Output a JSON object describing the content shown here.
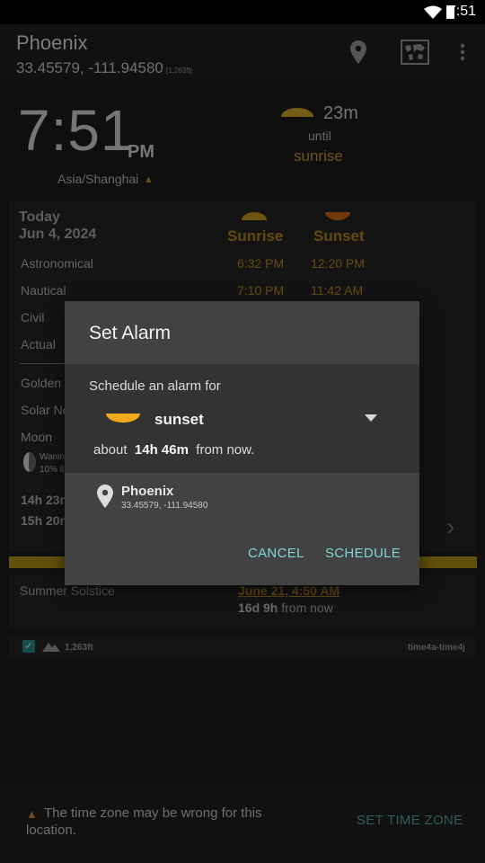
{
  "status_bar": {
    "time": "7:51"
  },
  "app_bar": {
    "title": "Phoenix",
    "coords": "33.45579, -111.94580",
    "altitude_small": "[1,263ft]"
  },
  "clock": {
    "time": "7:51",
    "ampm": "PM",
    "timezone": "Asia/Shanghai",
    "warn_glyph": "▲"
  },
  "countdown": {
    "value": "23m",
    "until": "until",
    "event": "sunrise"
  },
  "card": {
    "today": "Today",
    "date": "Jun 4, 2024",
    "col_sunrise": "Sunrise",
    "col_sunset": "Sunset",
    "rows": [
      {
        "label": "Astronomical",
        "sunrise": "6:32 PM",
        "sunset": "12:20 PM"
      },
      {
        "label": "Nautical",
        "sunrise": "7:10 PM",
        "sunset": "11:42 AM"
      },
      {
        "label": "Civil"
      },
      {
        "label": "Actual"
      },
      {
        "label": "Golden"
      },
      {
        "label": "Solar No"
      },
      {
        "label": "Moon"
      }
    ],
    "moon_line1": "Wanin",
    "moon_line2": "10% il",
    "summary1": "14h 23n",
    "summary2": "15h 20n",
    "chevron": "›"
  },
  "solstice": {
    "label": "Summer Solstice",
    "date": "June 21, 4:50 AM",
    "from_value": "16d 9h",
    "from_suffix": "from now"
  },
  "info_bar": {
    "check": "✓",
    "altitude": "1,263ft",
    "version": "time4a-time4j"
  },
  "dialog": {
    "title": "Set Alarm",
    "prompt": "Schedule an alarm for",
    "event": "sunset",
    "about_prefix": "about",
    "about_value": "14h 46m",
    "about_suffix": "from now.",
    "location_name": "Phoenix",
    "location_coords": "33.45579, -111.94580",
    "cancel": "CANCEL",
    "schedule": "SCHEDULE"
  },
  "bottom": {
    "warn_glyph": "▲",
    "message": "The time zone may be wrong for this location.",
    "action": "SET TIME ZONE"
  },
  "colors": {
    "accent_gold": "#b8871e",
    "sun_orange": "#f0a81c",
    "teal_button": "#7fd6d0",
    "dialog_bg": "#424242"
  },
  "icons": {
    "appbar": [
      "location-pin-icon",
      "world-map-icon",
      "overflow-menu-icon"
    ],
    "dialog": [
      "sunset-icon",
      "dropdown-arrow-icon",
      "location-pin-icon"
    ]
  }
}
